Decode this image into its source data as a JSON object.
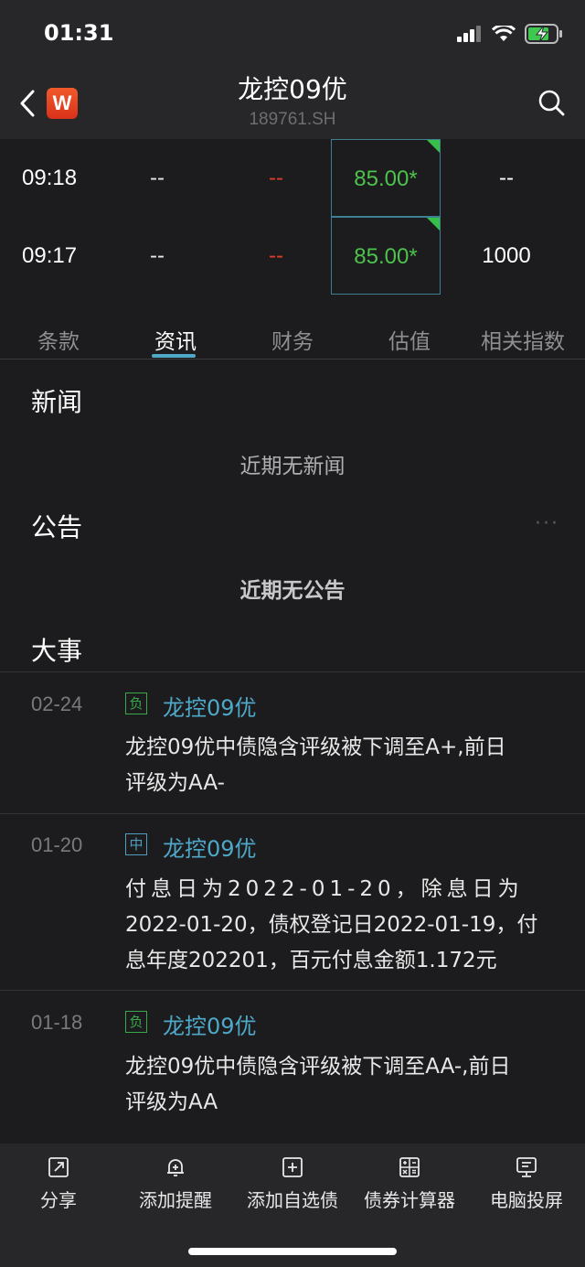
{
  "status_bar": {
    "time": "01:31"
  },
  "header": {
    "app_icon_letter": "W",
    "title": "龙控09优",
    "code": "189761.SH"
  },
  "quotes": [
    {
      "time": "09:18",
      "col_a": "--",
      "col_b": "--",
      "price": "85.00*",
      "volume": "--"
    },
    {
      "time": "09:17",
      "col_a": "--",
      "col_b": "--",
      "price": "85.00*",
      "volume": "1000"
    }
  ],
  "tabs": [
    {
      "label": "条款"
    },
    {
      "label": "资讯"
    },
    {
      "label": "财务"
    },
    {
      "label": "估值"
    },
    {
      "label": "相关指数"
    }
  ],
  "active_tab": "资讯",
  "news": {
    "title": "新闻",
    "empty": "近期无新闻"
  },
  "announcements": {
    "title": "公告",
    "more": "···",
    "empty": "近期无公告"
  },
  "events": {
    "title": "大事",
    "items": [
      {
        "date": "02-24",
        "tag": "负",
        "name": "龙控09优",
        "line1": "龙控09优中债隐含评级被下调至A+,前日",
        "line2": "评级为AA-"
      },
      {
        "date": "01-20",
        "tag": "中",
        "name": "龙控09优",
        "line1": "付息日为2022-01-20，除息日为",
        "line2": "2022-01-20，债权登记日2022-01-19，付",
        "line3": "息年度202201，百元付息金额1.172元"
      },
      {
        "date": "01-18",
        "tag": "负",
        "name": "龙控09优",
        "line1": "龙控09优中债隐含评级被下调至AA-,前日",
        "line2": "评级为AA"
      }
    ]
  },
  "bottom_bar": [
    {
      "label": "分享",
      "icon": "share-icon"
    },
    {
      "label": "添加提醒",
      "icon": "bell-plus-icon"
    },
    {
      "label": "添加自选债",
      "icon": "add-square-icon"
    },
    {
      "label": "债券计算器",
      "icon": "calculator-icon"
    },
    {
      "label": "电脑投屏",
      "icon": "screen-cast-icon"
    }
  ],
  "colors": {
    "accent": "#4ea8c8",
    "price_green": "#4cc24c",
    "down_red": "#e03a2a",
    "tag_negative": "#3aa84a",
    "tag_neutral": "#4e9ec0"
  }
}
